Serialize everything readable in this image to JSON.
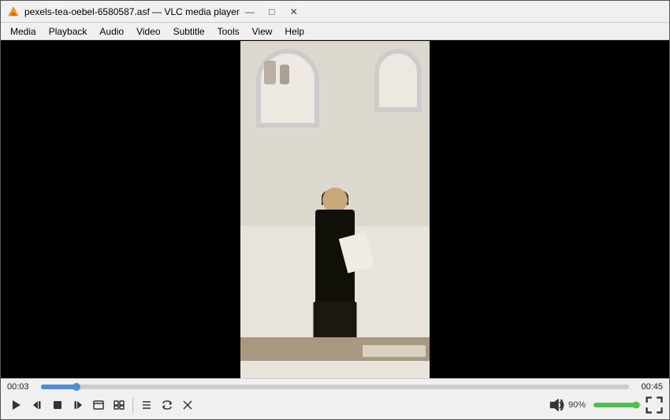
{
  "titlebar": {
    "icon": "🎵",
    "title": "pexels-tea-oebel-6580587.asf — VLC media player",
    "minimize_label": "—",
    "maximize_label": "□",
    "close_label": "✕"
  },
  "menubar": {
    "items": [
      {
        "id": "menu-media",
        "label": "Media"
      },
      {
        "id": "menu-playback",
        "label": "Playback"
      },
      {
        "id": "menu-audio",
        "label": "Audio"
      },
      {
        "id": "menu-video",
        "label": "Video"
      },
      {
        "id": "menu-subtitle",
        "label": "Subtitle"
      },
      {
        "id": "menu-tools",
        "label": "Tools"
      },
      {
        "id": "menu-view",
        "label": "View"
      },
      {
        "id": "menu-help",
        "label": "Help"
      }
    ]
  },
  "player": {
    "time_current": "00:03",
    "time_total": "00:45",
    "progress_pct": 6,
    "volume_pct": 90,
    "volume_label": "90%"
  },
  "controls": {
    "play_label": "▶",
    "prev_label": "⏮",
    "stop_label": "■",
    "next_label": "⏭",
    "fullscreen_label": "⛶",
    "playlist_label": "☰",
    "extended_label": "⚙",
    "effects_label": "♫",
    "record_label": "●",
    "snapshot_label": "📷",
    "loop_label": "🔁",
    "random_label": "✕"
  }
}
